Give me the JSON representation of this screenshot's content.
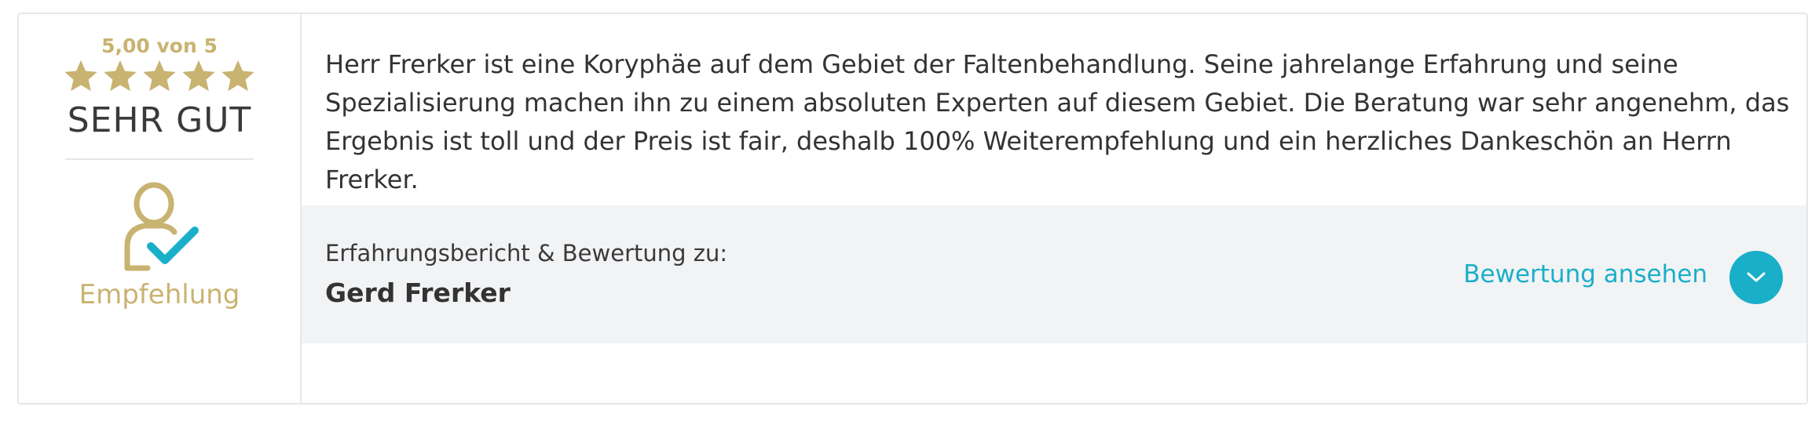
{
  "rating": {
    "score_text": "5,00 von 5",
    "stars_filled": 5,
    "stars_total": 5,
    "label": "SEHR GUT",
    "star_color": "#c9b371"
  },
  "recommendation": {
    "icon": "user-check-icon",
    "label": "Empfehlung",
    "icon_color": "#c9b371",
    "check_color": "#1aafc9"
  },
  "review": {
    "text": "Herr Frerker ist eine Koryphäe auf dem Gebiet der Faltenbehandlung. Seine jahrelange Erfahrung und seine Spezialisierung machen ihn zu einem absoluten Experten auf diesem Gebiet. Die Beratung war sehr angenehm, das Ergebnis ist toll und der Preis ist fair, deshalb 100% Weiterempfehlung und ein herzliches Dankeschön an Herrn Frerker."
  },
  "meta": {
    "label": "Erfahrungsbericht & Bewertung zu:",
    "name": "Gerd Frerker",
    "link_text": "Bewertung ansehen",
    "button_icon": "chevron-down-icon",
    "accent_color": "#1aafc9"
  }
}
